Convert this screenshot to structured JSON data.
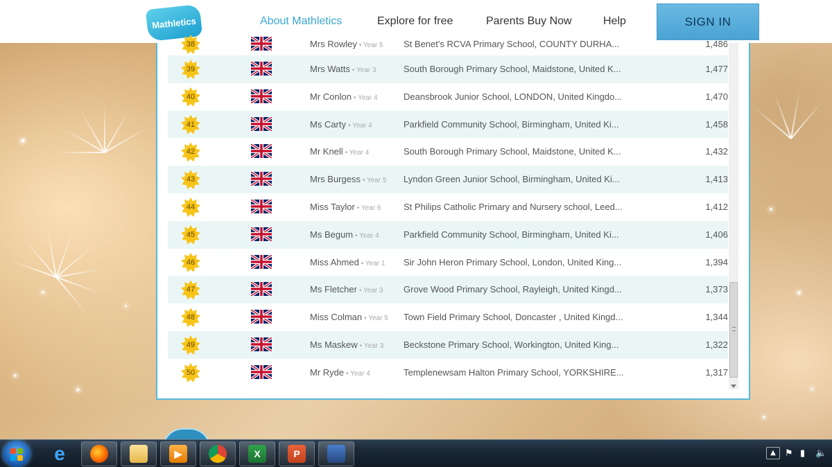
{
  "header": {
    "logo_text": "Mathletics",
    "nav": [
      {
        "label": "About Mathletics",
        "active": true
      },
      {
        "label": "Explore for free",
        "active": false
      },
      {
        "label": "Parents Buy Now",
        "active": false
      },
      {
        "label": "Help",
        "active": false
      }
    ],
    "signin_label": "SIGN IN"
  },
  "leaderboard": {
    "rows": [
      {
        "rank": "38",
        "teacher": "Mrs Rowley",
        "year": "• Year 5",
        "school": "St Benet's RCVA Primary School, COUNTY DURHA...",
        "score": "1,486"
      },
      {
        "rank": "39",
        "teacher": "Mrs Watts",
        "year": "• Year 3",
        "school": "South Borough Primary School, Maidstone, United K...",
        "score": "1,477"
      },
      {
        "rank": "40",
        "teacher": "Mr Conlon",
        "year": "• Year 4",
        "school": "Deansbrook Junior School, LONDON, United Kingdo...",
        "score": "1,470"
      },
      {
        "rank": "41",
        "teacher": "Ms Carty",
        "year": "• Year 4",
        "school": "Parkfield Community School, Birmingham, United Ki...",
        "score": "1,458"
      },
      {
        "rank": "42",
        "teacher": "Mr Knell",
        "year": "• Year 4",
        "school": "South Borough Primary School, Maidstone, United K...",
        "score": "1,432"
      },
      {
        "rank": "43",
        "teacher": "Mrs Burgess",
        "year": "• Year 5",
        "school": "Lyndon Green Junior School, Birmingham, United Ki...",
        "score": "1,413"
      },
      {
        "rank": "44",
        "teacher": "Miss Taylor",
        "year": "• Year 6",
        "school": "St Philips Catholic Primary and Nursery school, Leed...",
        "score": "1,412"
      },
      {
        "rank": "45",
        "teacher": "Ms Begum",
        "year": "• Year 4",
        "school": "Parkfield Community School, Birmingham, United Ki...",
        "score": "1,406"
      },
      {
        "rank": "46",
        "teacher": "Miss Ahmed",
        "year": "• Year 1",
        "school": "Sir John Heron Primary School, London, United King...",
        "score": "1,394"
      },
      {
        "rank": "47",
        "teacher": "Ms Fletcher",
        "year": "• Year 3",
        "school": "Grove Wood Primary School, Rayleigh, United Kingd...",
        "score": "1,373"
      },
      {
        "rank": "48",
        "teacher": "Miss Colman",
        "year": "• Year 5",
        "school": "Town Field Primary School, Doncaster , United Kingd...",
        "score": "1,344"
      },
      {
        "rank": "49",
        "teacher": "Ms Maskew",
        "year": "• Year 3",
        "school": "Beckstone Primary School, Workington, United King...",
        "score": "1,322"
      },
      {
        "rank": "50",
        "teacher": "Mr Ryde",
        "year": "• Year 4",
        "school": "Templenewsam Halton Primary School, YORKSHIRE...",
        "score": "1,317"
      }
    ]
  },
  "taskbar": {
    "apps": [
      {
        "name": "internet-explorer-icon",
        "glyph": "e"
      },
      {
        "name": "firefox-icon",
        "glyph": ""
      },
      {
        "name": "file-explorer-icon",
        "glyph": ""
      },
      {
        "name": "media-player-icon",
        "glyph": "▶"
      },
      {
        "name": "chrome-icon",
        "glyph": ""
      },
      {
        "name": "excel-icon",
        "glyph": "X"
      },
      {
        "name": "powerpoint-icon",
        "glyph": "P"
      },
      {
        "name": "network-app-icon",
        "glyph": ""
      }
    ]
  },
  "colors": {
    "accent": "#3aa7cf",
    "signin_bg": "#5aaedb",
    "row_alt": "#eaf6f6",
    "star": "#f7c419"
  }
}
